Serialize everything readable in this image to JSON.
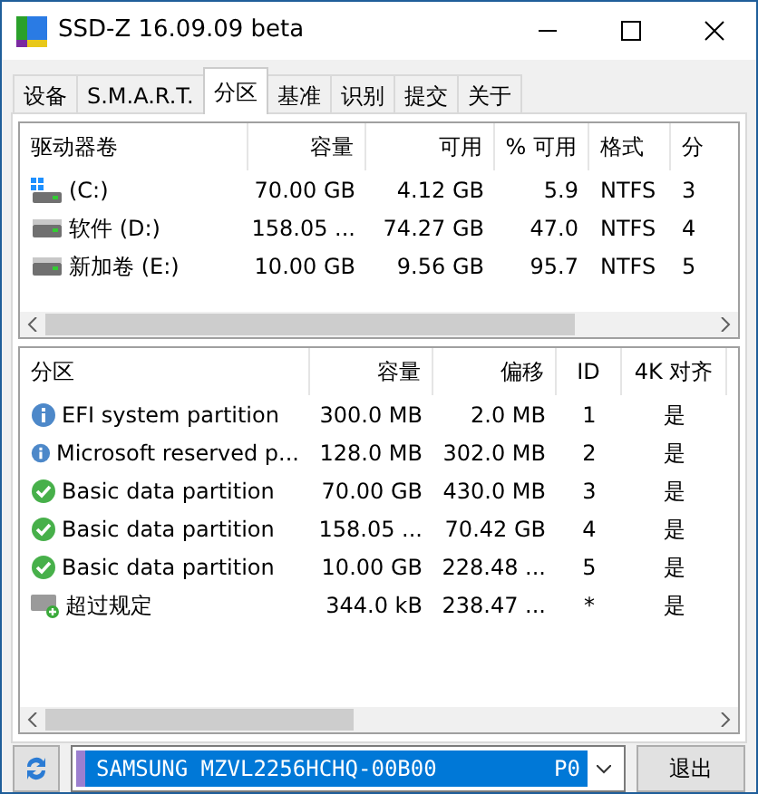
{
  "window": {
    "title": "SSD-Z 16.09.09 beta"
  },
  "tabs": [
    {
      "label": "设备",
      "selected": false
    },
    {
      "label": "S.M.A.R.T.",
      "selected": false
    },
    {
      "label": "分区",
      "selected": true
    },
    {
      "label": "基准",
      "selected": false
    },
    {
      "label": "识别",
      "selected": false
    },
    {
      "label": "提交",
      "selected": false
    },
    {
      "label": "关于",
      "selected": false
    }
  ],
  "volumes": {
    "columns": [
      "驱动器卷",
      "容量",
      "可用",
      "% 可用",
      "格式",
      "分"
    ],
    "rows": [
      {
        "kind": "system",
        "cells": [
          "(C:)",
          "70.00 GB",
          "4.12 GB",
          "5.9",
          "NTFS",
          "3"
        ]
      },
      {
        "kind": "disk",
        "cells": [
          "软件 (D:)",
          "158.05 ...",
          "74.27 GB",
          "47.0",
          "NTFS",
          "4"
        ]
      },
      {
        "kind": "disk",
        "cells": [
          "新加卷 (E:)",
          "10.00 GB",
          "9.56 GB",
          "95.7",
          "NTFS",
          "5"
        ]
      }
    ]
  },
  "partitions": {
    "columns": [
      "分区",
      "容量",
      "偏移",
      "ID",
      "4K 对齐"
    ],
    "rows": [
      {
        "kind": "info",
        "cells": [
          "EFI system partition",
          "300.0 MB",
          "2.0 MB",
          "1",
          "是"
        ]
      },
      {
        "kind": "info",
        "cells": [
          "Microsoft reserved p...",
          "128.0 MB",
          "302.0 MB",
          "2",
          "是"
        ]
      },
      {
        "kind": "ok",
        "cells": [
          "Basic data partition",
          "70.00 GB",
          "430.0 MB",
          "3",
          "是"
        ]
      },
      {
        "kind": "ok",
        "cells": [
          "Basic data partition",
          "158.05 ...",
          "70.42 GB",
          "4",
          "是"
        ]
      },
      {
        "kind": "ok",
        "cells": [
          "Basic data partition",
          "10.00 GB",
          "228.48 ...",
          "5",
          "是"
        ]
      },
      {
        "kind": "unallocated",
        "cells": [
          "超过规定",
          "344.0 kB",
          "238.47 ...",
          "*",
          "是"
        ]
      }
    ]
  },
  "drive_select": {
    "value": "SAMSUNG MZVL2256HCHQ-00B00",
    "column_2": "P0"
  },
  "buttons": [
    "退出"
  ]
}
